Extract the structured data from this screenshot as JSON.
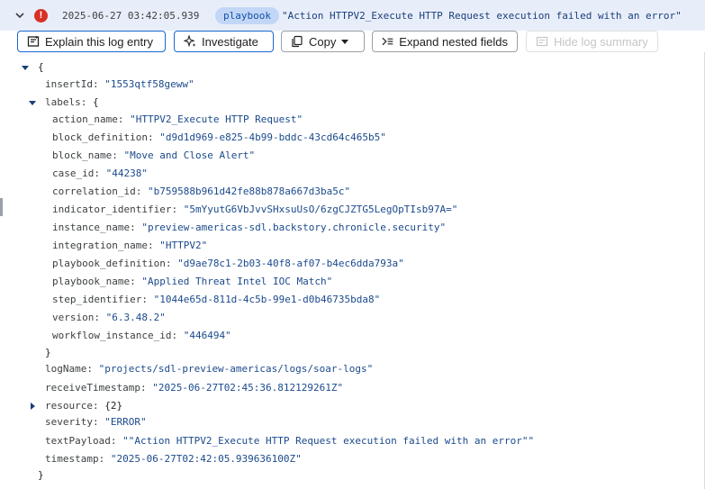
{
  "header": {
    "timestamp": "2025-06-27 03:42:05.939",
    "source_chip": "playbook",
    "summary": "\"Action HTTPV2_Execute HTTP Request execution failed with an error\""
  },
  "toolbar": {
    "explain_label": "Explain this log entry",
    "investigate_label": "Investigate",
    "copy_label": "Copy",
    "expand_label": "Expand nested fields",
    "hide_summary_label": "Hide log summary"
  },
  "log": {
    "open_brace": "{",
    "close_brace": "}",
    "insertId": {
      "key": "insertId:",
      "value": "\"1553qtf58geww\""
    },
    "labels": {
      "key": "labels:",
      "open": "{",
      "close": "}",
      "items": [
        {
          "key": "action_name:",
          "value": "\"HTTPV2_Execute HTTP Request\""
        },
        {
          "key": "block_definition:",
          "value": "\"d9d1d969-e825-4b99-bddc-43cd64c465b5\""
        },
        {
          "key": "block_name:",
          "value": "\"Move and Close Alert\""
        },
        {
          "key": "case_id:",
          "value": "\"44238\""
        },
        {
          "key": "correlation_id:",
          "value": "\"b759588b961d42fe88b878a667d3ba5c\""
        },
        {
          "key": "indicator_identifier:",
          "value": "\"5mYyutG6VbJvvSHxsuUsO/6zgCJZTG5LegOpTIsb97A=\""
        },
        {
          "key": "instance_name:",
          "value": "\"preview-americas-sdl.backstory.chronicle.security\""
        },
        {
          "key": "integration_name:",
          "value": "\"HTTPV2\""
        },
        {
          "key": "playbook_definition:",
          "value": "\"d9ae78c1-2b03-40f8-af07-b4ec6dda793a\""
        },
        {
          "key": "playbook_name:",
          "value": "\"Applied Threat Intel IOC Match\""
        },
        {
          "key": "step_identifier:",
          "value": "\"1044e65d-811d-4c5b-99e1-d0b46735bda8\""
        },
        {
          "key": "version:",
          "value": "\"6.3.48.2\""
        },
        {
          "key": "workflow_instance_id:",
          "value": "\"446494\""
        }
      ]
    },
    "logName": {
      "key": "logName:",
      "value": "\"projects/sdl-preview-americas/logs/soar-logs\""
    },
    "receiveTimestamp": {
      "key": "receiveTimestamp:",
      "value": "\"2025-06-27T02:45:36.812129261Z\""
    },
    "resource": {
      "key": "resource:",
      "value": "{2}"
    },
    "severity": {
      "key": "severity:",
      "value": "\"ERROR\""
    },
    "textPayload": {
      "key": "textPayload:",
      "value": "\"\"Action HTTPV2_Execute HTTP Request execution failed with an error\"\""
    },
    "timestamp": {
      "key": "timestamp:",
      "value": "\"2025-06-27T02:42:05.939636100Z\""
    }
  },
  "colors": {
    "accent": "#1967d2",
    "error": "#d93025",
    "header_bg": "#e8eef9",
    "chip_bg": "#c2d7f7"
  },
  "icons": [
    "chevron-down-icon",
    "error-icon",
    "sparkle-doc-icon",
    "sparkle-icon",
    "copy-icon",
    "expand-icon",
    "hide-summary-icon",
    "caret-down-icon"
  ]
}
